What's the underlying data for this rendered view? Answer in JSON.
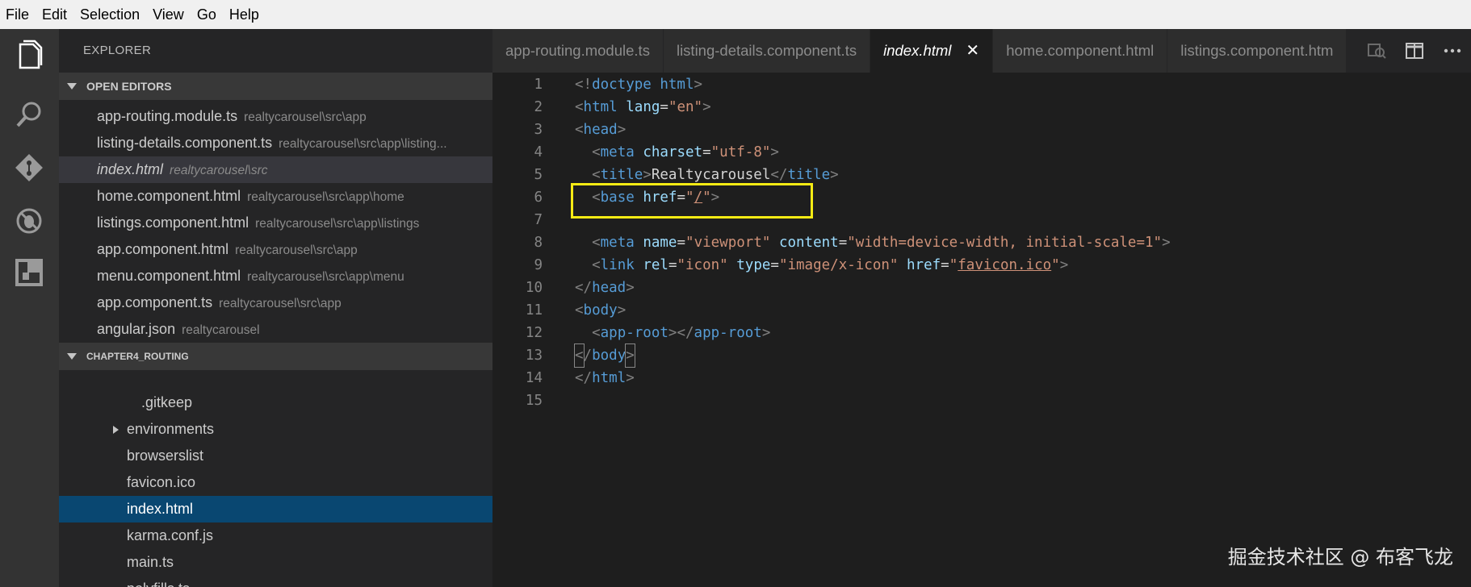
{
  "menu": [
    "File",
    "Edit",
    "Selection",
    "View",
    "Go",
    "Help"
  ],
  "activity_icons": [
    "files-icon",
    "search-icon",
    "source-control-icon",
    "debug-icon",
    "extensions-icon"
  ],
  "sidebar": {
    "title": "EXPLORER",
    "open_editors_label": "OPEN EDITORS",
    "open_editors": [
      {
        "name": "app-routing.module.ts",
        "path": "realtycarousel\\src\\app"
      },
      {
        "name": "listing-details.component.ts",
        "path": "realtycarousel\\src\\app\\listing..."
      },
      {
        "name": "index.html",
        "path": "realtycarousel\\src"
      },
      {
        "name": "home.component.html",
        "path": "realtycarousel\\src\\app\\home"
      },
      {
        "name": "listings.component.html",
        "path": "realtycarousel\\src\\app\\listings"
      },
      {
        "name": "app.component.html",
        "path": "realtycarousel\\src\\app"
      },
      {
        "name": "menu.component.html",
        "path": "realtycarousel\\src\\app\\menu"
      },
      {
        "name": "app.component.ts",
        "path": "realtycarousel\\src\\app"
      },
      {
        "name": "angular.json",
        "path": "realtycarousel"
      }
    ],
    "project_label": "CHAPTER4_ROUTING",
    "tree": [
      ".gitkeep",
      "environments",
      "browserslist",
      "favicon.ico",
      "index.html",
      "karma.conf.js",
      "main.ts",
      "polyfills.ts"
    ]
  },
  "tabs": [
    "app-routing.module.ts",
    "listing-details.component.ts",
    "index.html",
    "home.component.html",
    "listings.component.htm"
  ],
  "active_tab_close": "✕",
  "line_numbers": [
    "1",
    "2",
    "3",
    "4",
    "5",
    "6",
    "7",
    "8",
    "9",
    "10",
    "11",
    "12",
    "13",
    "14",
    "15"
  ],
  "code": {
    "l1_tag": "doctype html",
    "l2_tag": "html",
    "l2_attr": "lang",
    "l2_val": "\"en\"",
    "l3_tag": "head",
    "l4_tag": "meta",
    "l4_attr": "charset",
    "l4_val": "\"utf-8\"",
    "l5_tag": "title",
    "l5_text": "Realtycarousel",
    "l6_tag": "base",
    "l6_attr": "href",
    "l6_val_q1": "\"",
    "l6_val": "/",
    "l6_val_q2": "\"",
    "l8_tag": "meta",
    "l8_attr1": "name",
    "l8_val1": "\"viewport\"",
    "l8_attr2": "content",
    "l8_val2": "\"width=device-width, initial-scale=1\"",
    "l9_tag": "link",
    "l9_attr1": "rel",
    "l9_val1": "\"icon\"",
    "l9_attr2": "type",
    "l9_val2": "\"image/x-icon\"",
    "l9_attr3": "href",
    "l9_val3_q": "\"",
    "l9_val3": "favicon.ico",
    "l10_tag": "head",
    "l11_tag": "body",
    "l12_tag": "app-root",
    "l13_tag": "body",
    "l14_tag": "html"
  },
  "watermark": "掘金技术社区 @ 布客飞龙",
  "colors": {
    "highlight": "#f6eb14",
    "selection": "#094771"
  }
}
